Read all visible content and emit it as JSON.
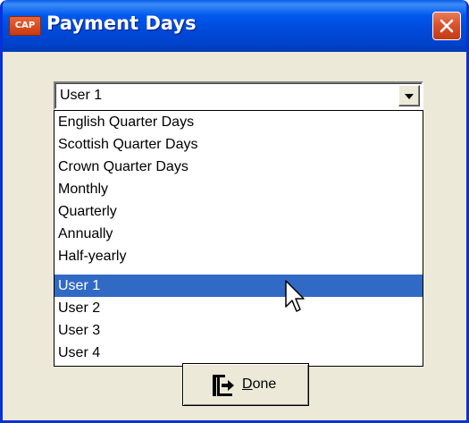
{
  "window": {
    "title": "Payment Days",
    "app_icon_text": "CAP",
    "accent_color": "#0054e3",
    "background_color": "#ece9d8"
  },
  "combo": {
    "value": "User 1"
  },
  "dropdown": {
    "items": [
      "English Quarter Days",
      "Scottish Quarter Days",
      "Crown Quarter Days",
      "Monthly",
      "Quarterly",
      "Annually",
      "Half-yearly",
      "User 1",
      "User 2",
      "User 3",
      "User 4"
    ],
    "selected_index": 7,
    "selection_color": "#316ac5"
  },
  "done_button": {
    "mnemonic": "D",
    "rest": "one",
    "icon": "exit-door-icon"
  },
  "icons": {
    "close": "close-icon",
    "dropdown_arrow": "chevron-down-icon",
    "cursor": "mouse-pointer-icon"
  }
}
